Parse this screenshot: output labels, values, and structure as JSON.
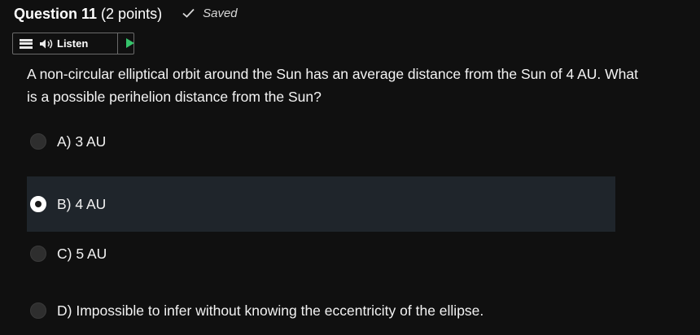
{
  "question": {
    "title": "Question 11",
    "points": "(2 points)",
    "saved_label": "Saved",
    "text": "A non-circular elliptical orbit around the Sun has an average distance from the Sun of 4 AU.  What is a possible perihelion distance from the Sun?"
  },
  "listen": {
    "label": "Listen"
  },
  "options": [
    {
      "label": "A) 3 AU",
      "selected": false
    },
    {
      "label": "B) 4 AU",
      "selected": true
    },
    {
      "label": "C) 5 AU",
      "selected": false
    },
    {
      "label": "D) Impossible to infer without knowing the eccentricity of the ellipse.",
      "selected": false
    }
  ],
  "colors": {
    "background": "#101010",
    "selected_row": "#1f252b",
    "play_accent": "#35c46b"
  },
  "icons": {
    "saved": "check-icon",
    "menu": "menu-icon",
    "listen": "speaker-icon",
    "play": "play-icon"
  }
}
